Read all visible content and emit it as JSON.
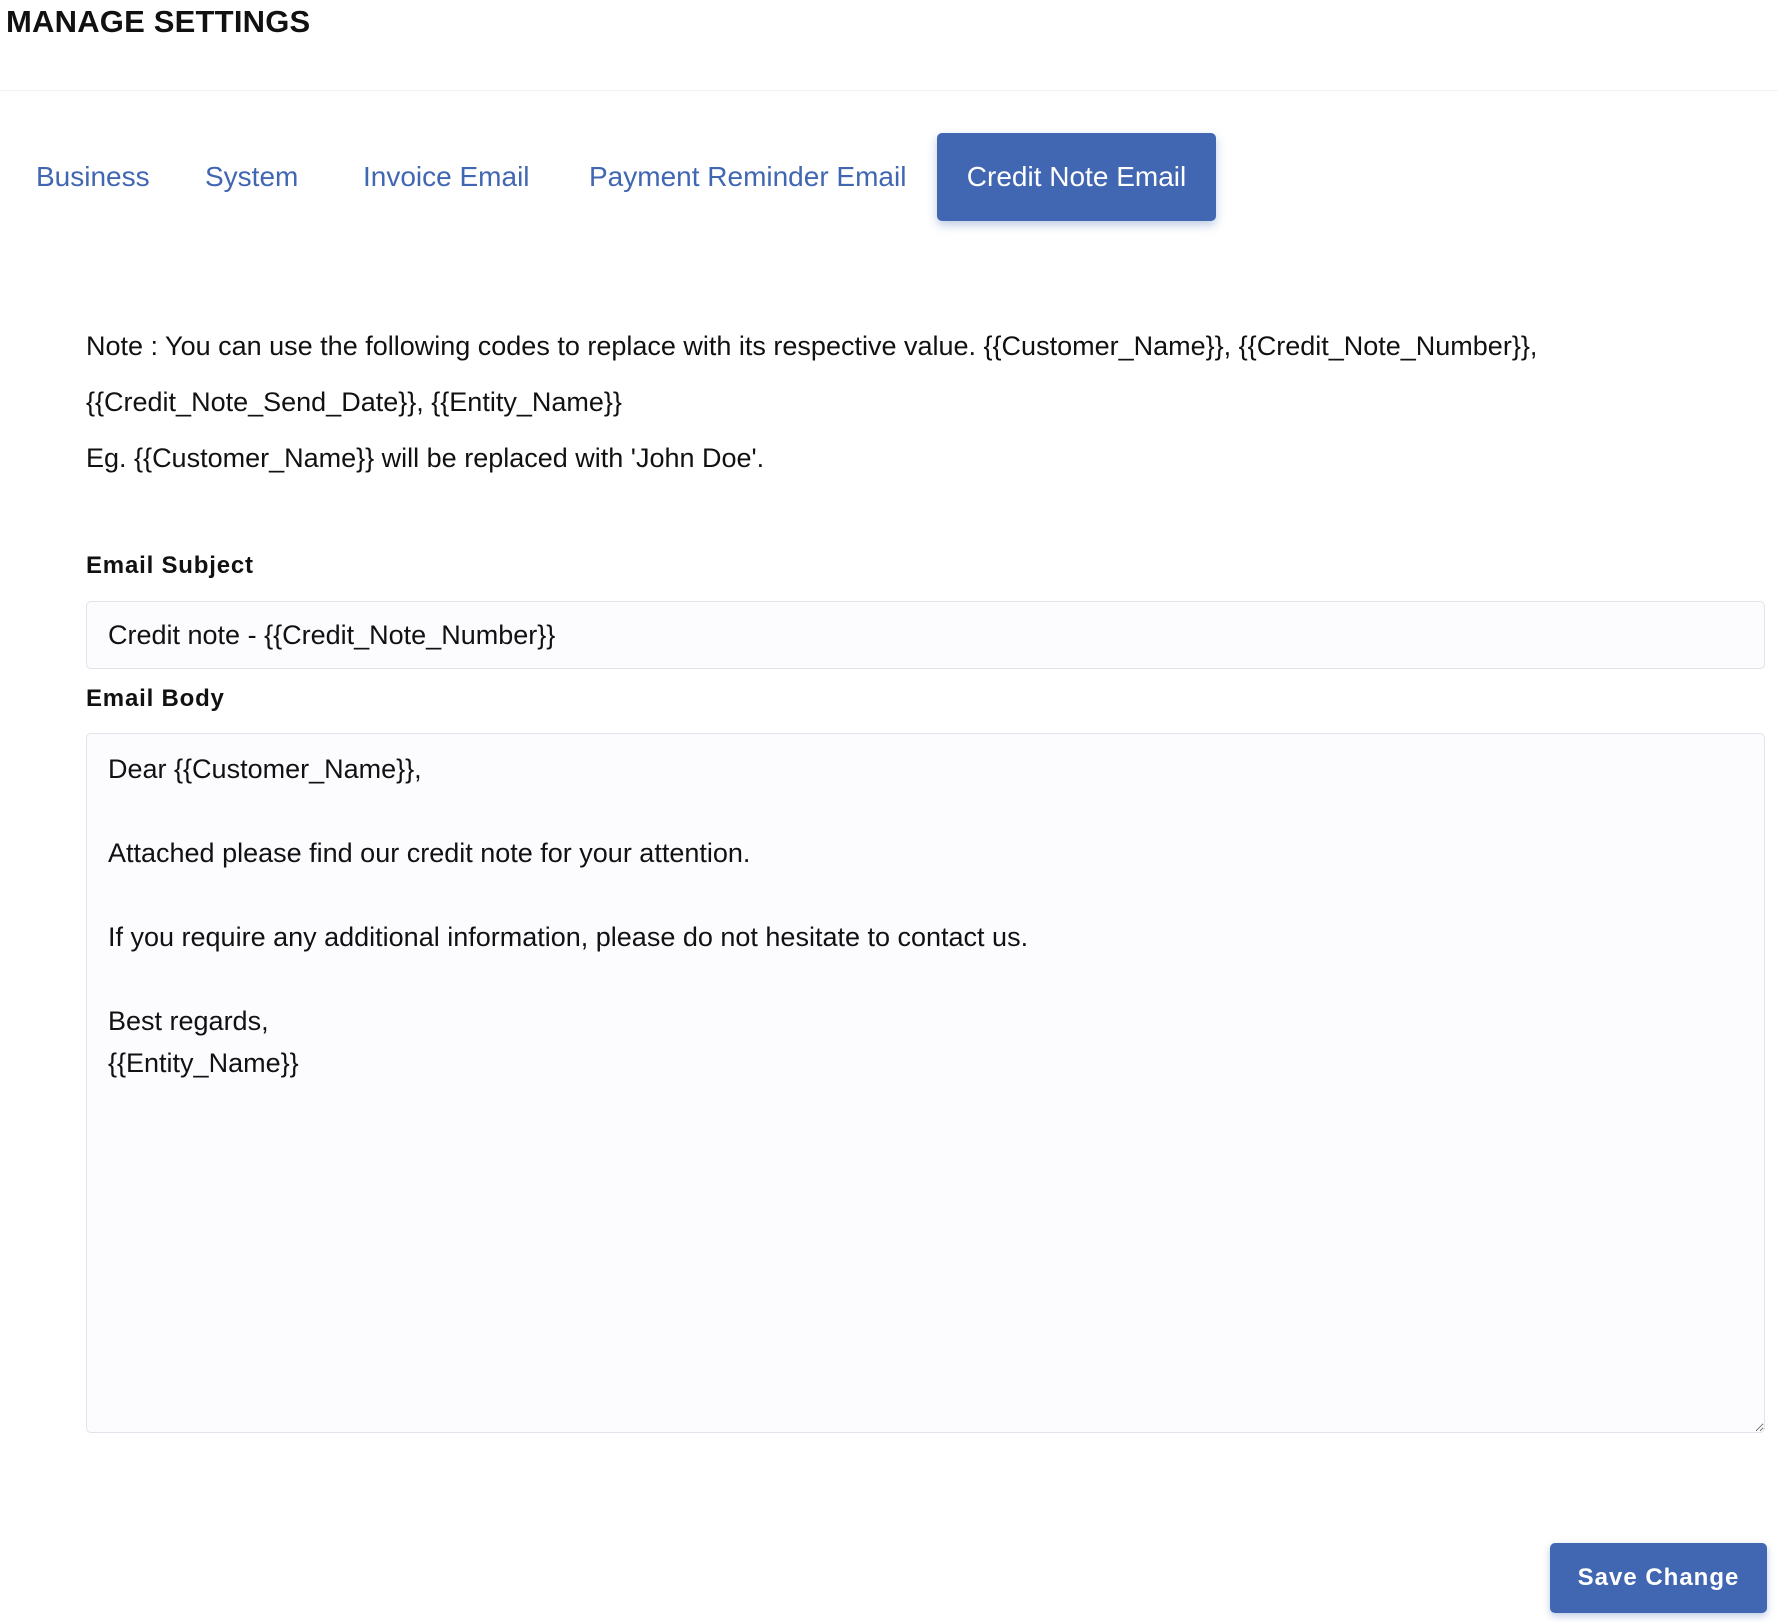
{
  "header": {
    "title": "MANAGE SETTINGS"
  },
  "tabs": [
    {
      "label": "Business",
      "active": false
    },
    {
      "label": "System",
      "active": false
    },
    {
      "label": "Invoice Email",
      "active": false
    },
    {
      "label": "Payment Reminder Email",
      "active": false
    },
    {
      "label": "Credit Note Email",
      "active": true
    }
  ],
  "note": {
    "line1": "Note : You can use the following codes to replace with its respective value. {{Customer_Name}}, {{Credit_Note_Number}},",
    "line2": "{{Credit_Note_Send_Date}}, {{Entity_Name}}",
    "line3": "Eg. {{Customer_Name}} will be replaced with 'John Doe'."
  },
  "form": {
    "subject_label": "Email Subject",
    "subject_value": "Credit note - {{Credit_Note_Number}}",
    "body_label": "Email Body",
    "body_value": "Dear {{Customer_Name}},\n\nAttached please find our credit note for your attention.\n\nIf you require any additional information, please do not hesitate to contact us.\n\nBest regards,\n{{Entity_Name}}"
  },
  "actions": {
    "save_label": "Save Change"
  },
  "colors": {
    "accent": "#4166b2",
    "field_background": "#fcfcff",
    "field_border": "#dfe3ea"
  }
}
